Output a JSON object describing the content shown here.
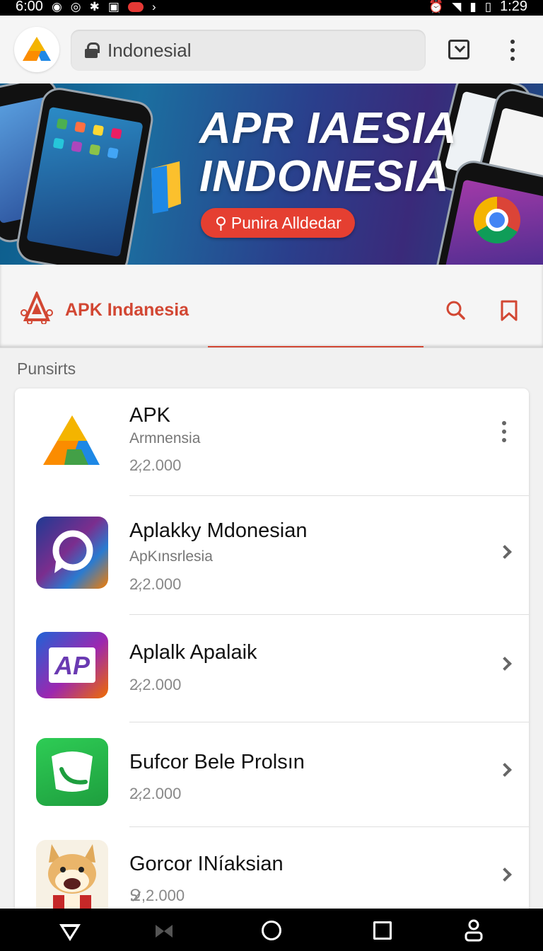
{
  "status_bar": {
    "time_left": "6:00",
    "time_right": "1:29",
    "left_icons": [
      "notification-icon",
      "location-icon",
      "bluetooth-icon",
      "mail-icon",
      "red-pill-icon",
      "overflow-chevron-icon"
    ],
    "right_icons": [
      "alarm-icon",
      "wifi-icon",
      "signal-icon",
      "battery-icon"
    ]
  },
  "browser": {
    "url": "Indonesial",
    "tab_icon": "tab-switcher-icon",
    "menu_icon": "overflow-menu-icon"
  },
  "banner": {
    "title_line1": "APR IAESIA",
    "title_line2": "INDONESIA",
    "button_label": "Punira Alldedar"
  },
  "site_header": {
    "brand_name": "APK Indanesia"
  },
  "section_label": "Punsirts",
  "apps": [
    {
      "title": "APK",
      "subtitle": "Armnensia",
      "count": "2̷,2.000",
      "action": "more-vert-icon",
      "icon": "apk-triangle-logo"
    },
    {
      "title": "Aplakky Mdonesian",
      "subtitle": "ApKınsrlesia",
      "count": "2̷,2.000",
      "action": "chevron-right-icon",
      "icon": "chat-bubble-gradient-logo"
    },
    {
      "title": "Aplalk Apalaik",
      "subtitle": "",
      "count": "2̷,2.000",
      "action": "chevron-right-icon",
      "icon": "ap-gradient-logo"
    },
    {
      "title": "Бufcor Bele Prolsın",
      "subtitle": "",
      "count": "2̷,2.000",
      "action": "chevron-right-icon",
      "icon": "green-phone-logo"
    },
    {
      "title": "Gorcor INíaksian",
      "subtitle": "",
      "count": "Ջ̷,2.000",
      "action": "chevron-right-icon",
      "icon": "cartoon-fox-logo"
    }
  ],
  "colors": {
    "accent": "#d24733",
    "banner_button": "#e53f31",
    "list_bg": "#ffffff",
    "page_bg": "#f1f1f1"
  }
}
